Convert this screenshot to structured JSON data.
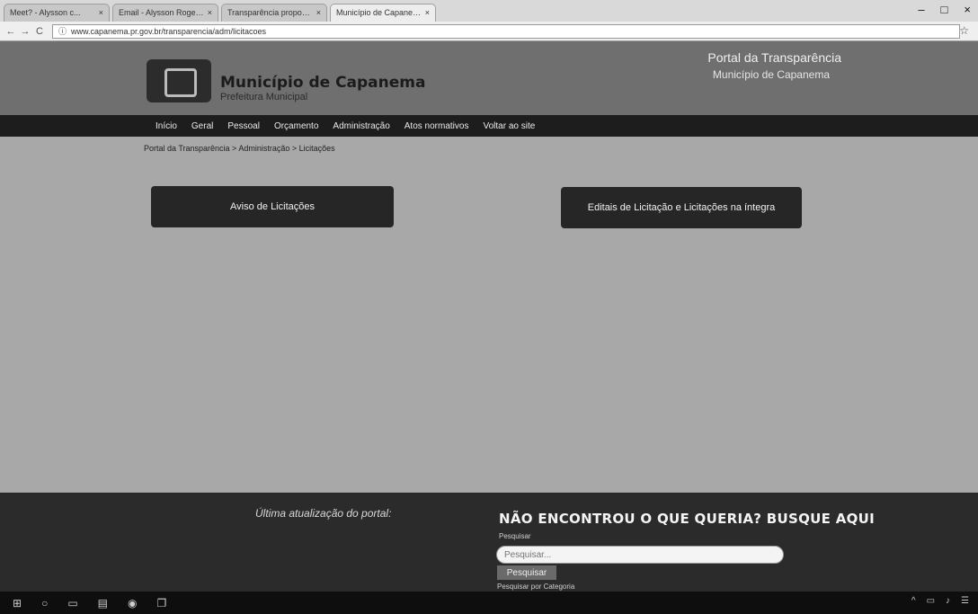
{
  "browser": {
    "tabs": [
      {
        "title": "Meet? - Alysson c..."
      },
      {
        "title": "Email - Alysson Rogerio..."
      },
      {
        "title": "Transparência propostas..."
      },
      {
        "title": "Município de Capanema"
      }
    ],
    "close_glyph": "×",
    "url": "www.capanema.pr.gov.br/transparencia/adm/licitacoes",
    "window_controls": {
      "minimize": "–",
      "maximize": "□",
      "close": "×"
    },
    "nav_icons": [
      "back-arrow-icon",
      "forward-arrow-icon",
      "reload-icon",
      "info-icon"
    ],
    "back": "←",
    "forward": "→",
    "reload": "C",
    "info": "ⓘ",
    "star": "☆"
  },
  "header": {
    "site_title": "Município de Capanema",
    "site_subtitle": "Prefeitura Municipal",
    "portal_title": "Portal da Transparência",
    "portal_subtitle": "Município de Capanema"
  },
  "nav": {
    "items": [
      {
        "label": "Início"
      },
      {
        "label": "Geral"
      },
      {
        "label": "Pessoal"
      },
      {
        "label": "Orçamento"
      },
      {
        "label": "Administração"
      },
      {
        "label": "Atos normativos"
      },
      {
        "label": "Voltar ao site"
      }
    ]
  },
  "breadcrumb": "Portal da Transparência > Administração > Licitações",
  "main": {
    "btn_aviso": "Aviso de Licitações",
    "btn_editais": "Editais de Licitação e Licitações na íntegra"
  },
  "footer": {
    "last_update": "Última atualização do portal:",
    "search_heading": "NÃO ENCONTROU O QUE QUERIA? BUSQUE AQUI",
    "search_label": "Pesquisar",
    "search_placeholder": "Pesquisar...",
    "search_button": "Pesquisar",
    "category_link": "Pesquisar por Categoria"
  },
  "taskbar": {
    "start": "⊞",
    "search": "○",
    "task_view": "▭",
    "file_explorer": "▤",
    "browser": "◉",
    "app": "❐"
  },
  "tray": {
    "items": [
      "^",
      "▭",
      "♪",
      "☰"
    ]
  }
}
